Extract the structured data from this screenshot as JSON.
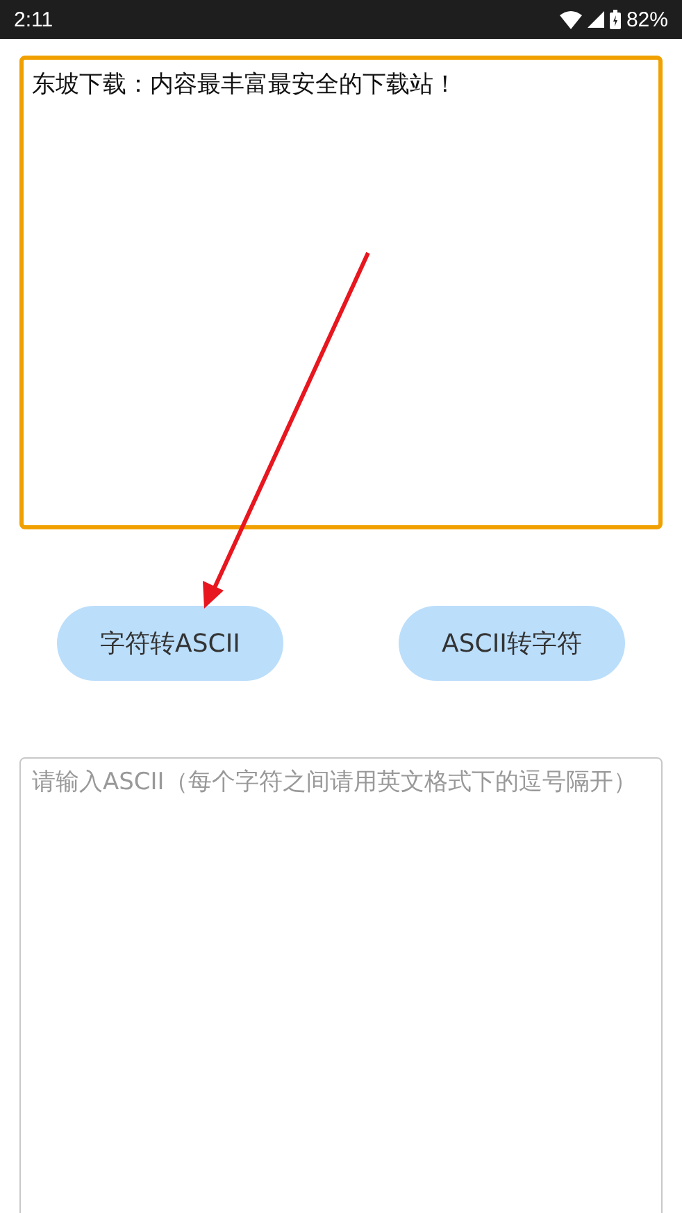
{
  "status_bar": {
    "time": "2:11",
    "battery": "82%"
  },
  "input": {
    "value": "东坡下载：内容最丰富最安全的下载站！",
    "focused": true
  },
  "buttons": [
    {
      "label": "字符转ASCII"
    },
    {
      "label": "ASCII转字符"
    }
  ],
  "output": {
    "placeholder": "请输入ASCII（每个字符之间请用英文格式下的逗号隔开）",
    "focused": false
  },
  "annotation": {
    "kind": "arrow"
  }
}
